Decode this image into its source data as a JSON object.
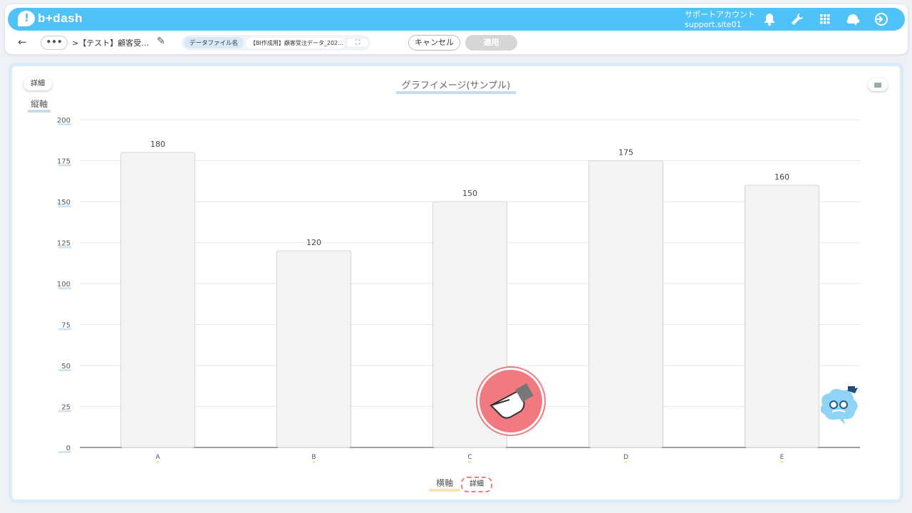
{
  "app": {
    "logo_text": "b+dash",
    "account_name": "サポートアカウント",
    "account_id": "support.site01"
  },
  "toolbar": {
    "more_label": "•••",
    "breadcrumb": ">【テスト】顧客受…",
    "file_label": "データファイル名",
    "file_value": "【BI作成用】顧客受注データ_202...",
    "expand_icon": "⛶",
    "cancel_label": "キャンセル",
    "apply_label": "適用"
  },
  "panel": {
    "top_detail_label": "詳細",
    "x_detail_label": "詳細",
    "y_axis_label": "縦軸",
    "x_axis_label": "横軸"
  },
  "colors": {
    "topbar": "#4fc3f7",
    "bar_fill": "#f4f4f4",
    "bar_stroke": "#d4d4d4",
    "pointer": "#f07a80"
  },
  "chart_data": {
    "type": "bar",
    "title": "グラフイメージ(サンプル)",
    "categories": [
      "A",
      "B",
      "C",
      "D",
      "E"
    ],
    "values": [
      180,
      120,
      150,
      175,
      160
    ],
    "yticks": [
      0,
      25,
      50,
      75,
      100,
      125,
      150,
      175,
      200
    ],
    "ylim": [
      0,
      200
    ],
    "xlabel": "横軸",
    "ylabel": "縦軸",
    "grid": true
  }
}
